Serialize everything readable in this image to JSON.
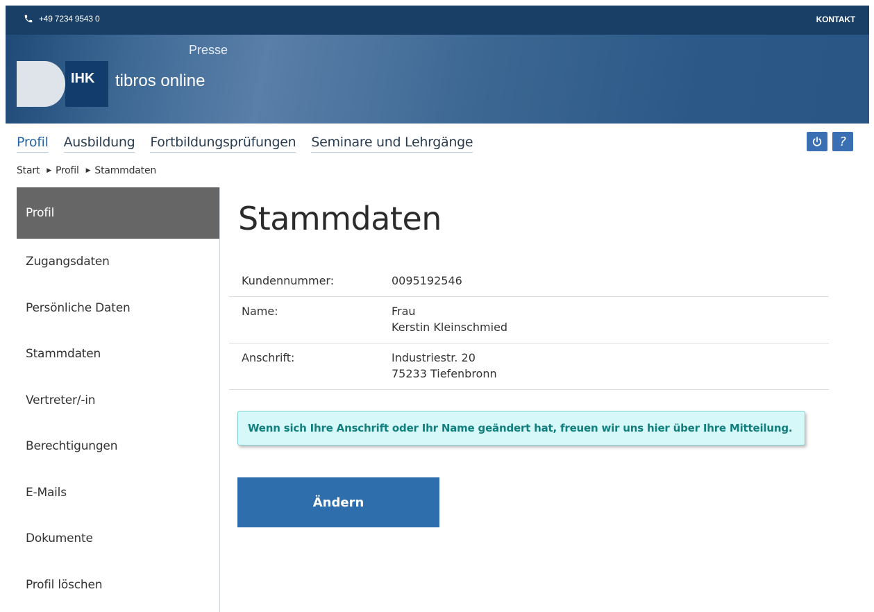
{
  "topbar": {
    "phone": "+49 7234 9543 0",
    "contact": "KONTAKT"
  },
  "banner": {
    "section": "Presse",
    "logo_text": "IHK",
    "brand": "tibros online"
  },
  "mainnav": {
    "items": [
      "Profil",
      "Ausbildung",
      "Fortbildungsprüfungen",
      "Seminare und Lehrgänge"
    ],
    "active": "Profil"
  },
  "icons": {
    "help": "?"
  },
  "breadcrumb": [
    "Start",
    "Profil",
    "Stammdaten"
  ],
  "sidebar": {
    "items": [
      "Profil",
      "Zugangsdaten",
      "Persönliche Daten",
      "Stammdaten",
      "Vertreter/-in",
      "Berechtigungen",
      "E-Mails",
      "Dokumente",
      "Profil löschen"
    ],
    "active": "Profil"
  },
  "main": {
    "title": "Stammdaten",
    "rows": [
      {
        "label": "Kundennummer:",
        "lines": [
          "0095192546"
        ]
      },
      {
        "label": "Name:",
        "lines": [
          "Frau",
          "Kerstin Kleinschmied"
        ]
      },
      {
        "label": "Anschrift:",
        "lines": [
          "Industriestr. 20",
          "75233 Tiefenbronn"
        ]
      }
    ],
    "info": "Wenn sich Ihre Anschrift oder Ihr Name geändert hat, freuen wir uns hier über Ihre Mitteilung.",
    "button": "Ändern"
  },
  "colors": {
    "topbar": "#1a3f66",
    "accent": "#2f6ead",
    "sidebar_active": "#666666",
    "info_bg": "#d6f8f8",
    "info_text": "#127f7f"
  }
}
